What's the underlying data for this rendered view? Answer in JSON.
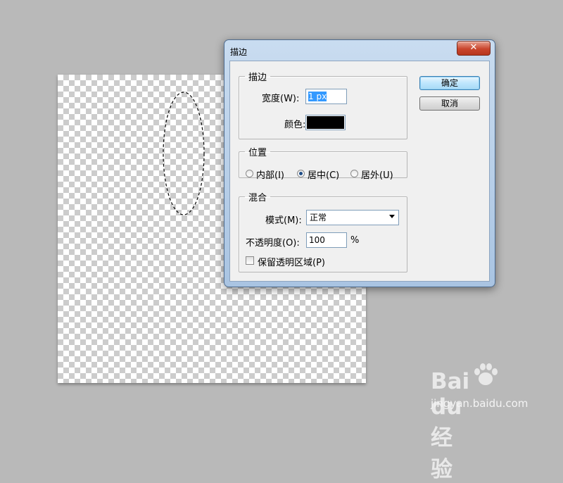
{
  "dialog": {
    "title": "描边",
    "close_glyph": "✕",
    "stroke_group": {
      "legend": "描边",
      "width_label": "宽度(W):",
      "width_value": "1 px",
      "color_label": "颜色:",
      "color_value": "#000000"
    },
    "position_group": {
      "legend": "位置",
      "options": [
        "内部(I)",
        "居中(C)",
        "居外(U)"
      ],
      "selected": "居中(C)"
    },
    "blend_group": {
      "legend": "混合",
      "mode_label": "模式(M):",
      "mode_value": "正常",
      "opacity_label": "不透明度(O):",
      "opacity_value": "100",
      "opacity_unit": "%",
      "preserve_label": "保留透明区域(P)",
      "preserve_checked": false
    },
    "ok_label": "确定",
    "cancel_label": "取消"
  },
  "watermark": {
    "brand": "Bai du 经验",
    "url": "jingyan.baidu.com"
  }
}
